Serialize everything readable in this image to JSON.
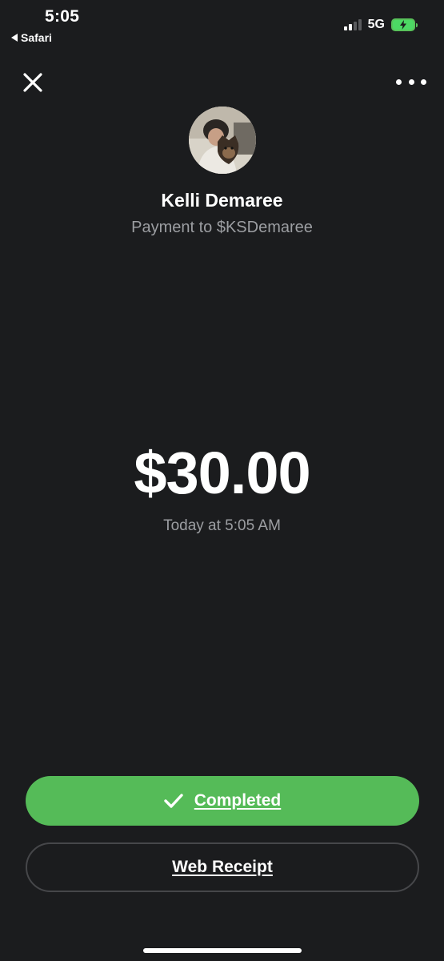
{
  "status_bar": {
    "time": "5:05",
    "back_app": "Safari",
    "network": "5G",
    "battery_state": "charging",
    "signal_bars_active": 2,
    "signal_bars_total": 4
  },
  "nav": {
    "close_icon": "close-icon",
    "more_icon": "more-options-icon"
  },
  "recipient": {
    "name": "Kelli Demaree",
    "subtitle": "Payment to $KSDemaree"
  },
  "payment": {
    "amount": "$30.00",
    "timestamp": "Today at 5:05 AM"
  },
  "actions": {
    "completed_label": "Completed",
    "completed_icon": "checkmark-icon",
    "web_receipt_label": "Web Receipt"
  },
  "colors": {
    "background": "#1b1c1e",
    "accent_green": "#55bb58",
    "secondary_text": "#9c9ea2"
  }
}
